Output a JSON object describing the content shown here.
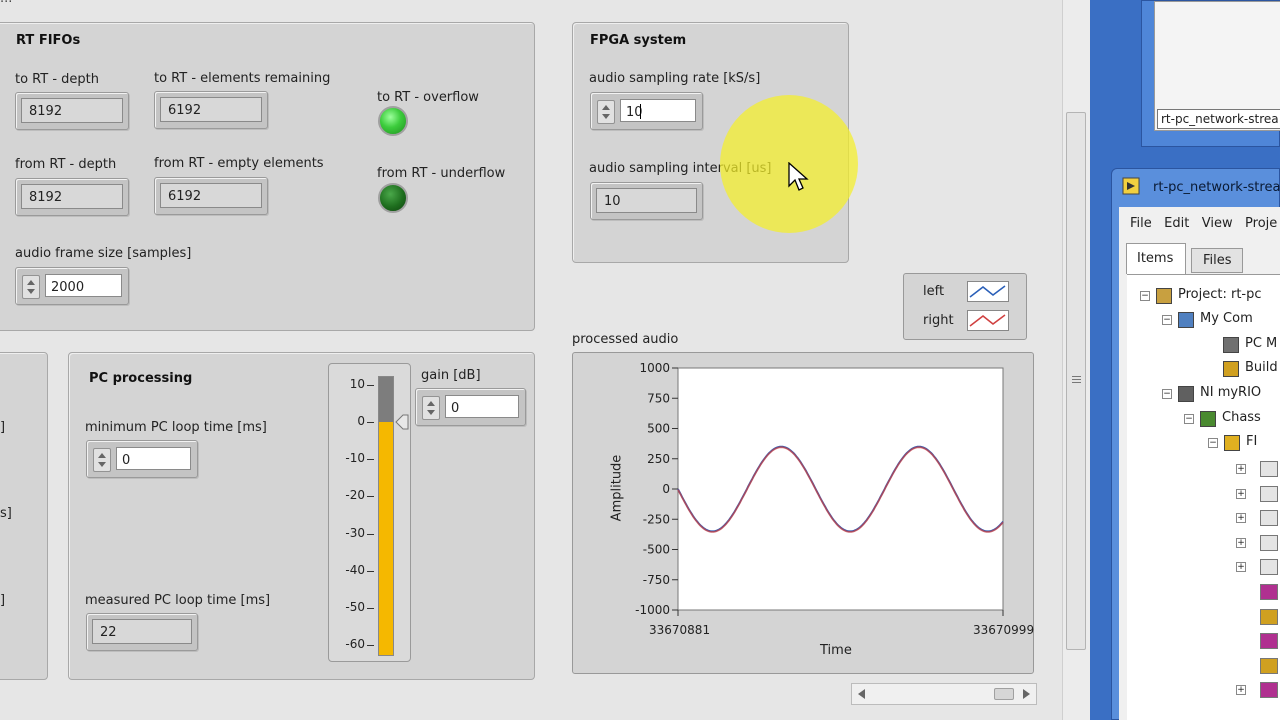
{
  "top_status": "...",
  "rt_fifos": {
    "title": "RT FIFOs",
    "to_rt_depth": {
      "label": "to RT - depth",
      "value": "8192"
    },
    "to_rt_remaining": {
      "label": "to RT - elements remaining",
      "value": "6192"
    },
    "to_rt_overflow_label": "to RT - overflow",
    "from_rt_depth": {
      "label": "from RT - depth",
      "value": "8192"
    },
    "from_rt_empty": {
      "label": "from RT - empty elements",
      "value": "6192"
    },
    "from_rt_underflow_label": "from RT - underflow",
    "audio_frame_size": {
      "label": "audio frame size [samples]",
      "value": "2000"
    },
    "led_colors": {
      "on": "#33c233",
      "dark": "#1e6e1e"
    }
  },
  "fpga": {
    "title": "FPGA system",
    "sampling_rate": {
      "label": "audio sampling rate [kS/s]",
      "value": "10"
    },
    "sampling_interval": {
      "label": "audio sampling interval [us]",
      "value": "10"
    }
  },
  "pc_processing": {
    "title": "PC processing",
    "min_loop": {
      "label": "minimum PC loop time [ms]",
      "value": "0"
    },
    "measured_loop": {
      "label": "measured PC loop time [ms]",
      "value": "22"
    },
    "gain": {
      "label": "gain [dB]",
      "value": "0"
    },
    "meter_ticks": [
      "10",
      "0",
      "-10",
      "-20",
      "-30",
      "-40",
      "-50",
      "-60"
    ],
    "meter_level_db": 0,
    "meter_color": "#f5b800"
  },
  "legend": {
    "left": "left",
    "right": "right"
  },
  "chart_data": {
    "type": "line",
    "title": "processed audio",
    "xlabel": "Time",
    "ylabel": "Amplitude",
    "xlim": [
      33670881,
      33670999
    ],
    "ylim": [
      -1000,
      1000
    ],
    "y_ticks": [
      "1000",
      "750",
      "500",
      "250",
      "0",
      "-250",
      "-500",
      "-750",
      "-1000"
    ],
    "x_ticks": [
      "33670881",
      "33670999"
    ],
    "series": [
      {
        "name": "left",
        "color": "#2a5fb8",
        "amplitude": 350,
        "period": 50,
        "phase_x": 33670881
      },
      {
        "name": "right",
        "color": "#d04040",
        "amplitude": 350,
        "period": 50,
        "phase_x": 33670881
      }
    ]
  },
  "project": {
    "window_title": "rt-pc_network-strea",
    "top_window_path": "rt-pc_network-strea",
    "menu": [
      "File",
      "Edit",
      "View",
      "Proje"
    ],
    "tabs": [
      "Items",
      "Files"
    ],
    "tree": [
      "Project: rt-pc",
      "My Com",
      "PC M",
      "Build",
      "NI myRIO",
      "Chass",
      "FI"
    ]
  }
}
